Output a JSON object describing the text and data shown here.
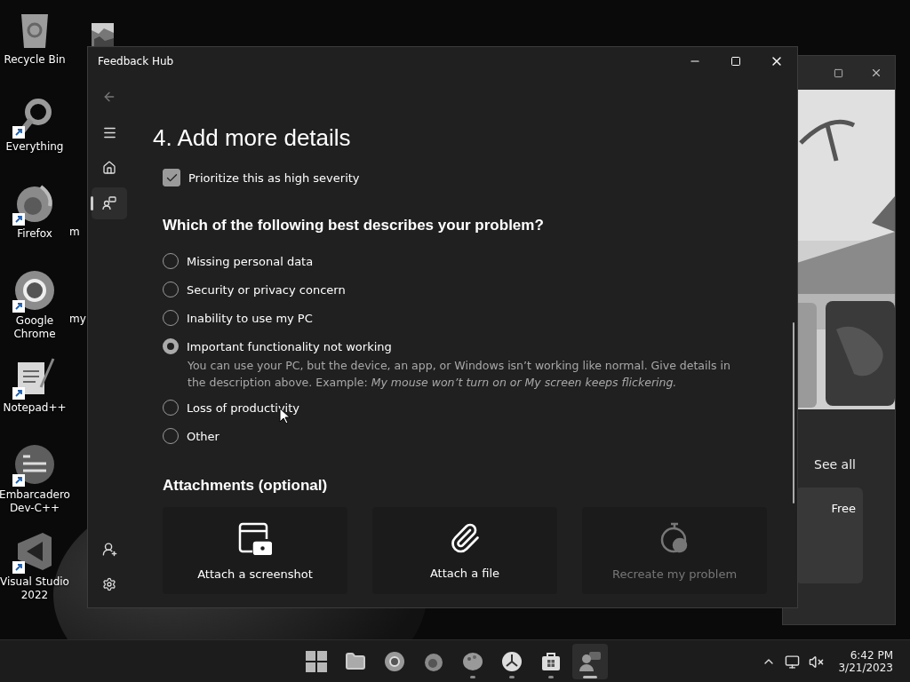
{
  "desktop_icons": [
    {
      "label": "Recycle Bin",
      "kind": "bin",
      "shortcut": false
    },
    {
      "label": "Everything",
      "kind": "magnifier",
      "shortcut": true
    },
    {
      "label": "Firefox",
      "kind": "firefox",
      "shortcut": true
    },
    {
      "label": "Google Chrome",
      "kind": "chrome",
      "shortcut": true
    },
    {
      "label": "Notepad++",
      "kind": "notepad",
      "shortcut": true
    },
    {
      "label": "Embarcadero Dev-C++",
      "kind": "devcpp",
      "shortcut": true
    },
    {
      "label": "Visual Studio 2022",
      "kind": "vs",
      "shortcut": true
    }
  ],
  "desktop_column_2": [
    {
      "label": "m"
    },
    {
      "label": "my"
    }
  ],
  "background_window": {
    "see_all": "See all",
    "card_label": "Free"
  },
  "window": {
    "title": "Feedback Hub",
    "nav_top": [
      {
        "kind": "back",
        "selected": false
      },
      {
        "kind": "menu",
        "selected": false
      },
      {
        "kind": "home",
        "selected": false
      },
      {
        "kind": "feedback",
        "selected": true
      }
    ],
    "nav_bottom": [
      {
        "kind": "add-user"
      },
      {
        "kind": "settings"
      }
    ],
    "heading": "4. Add more details",
    "severity": {
      "label": "Prioritize this as high severity",
      "checked": true
    },
    "question": "Which of the following best describes your problem?",
    "options": [
      {
        "label": "Missing personal data",
        "selected": false
      },
      {
        "label": "Security or privacy concern",
        "selected": false
      },
      {
        "label": "Inability to use my PC",
        "selected": false
      },
      {
        "label": "Important functionality not working",
        "selected": true,
        "description": "You can use your PC, but the device, an app, or Windows isn’t working like normal. Give details in the description above. Example: *My mouse won’t turn on or My screen keeps flickering.*"
      },
      {
        "label": "Loss of productivity",
        "selected": false
      },
      {
        "label": "Other",
        "selected": false
      }
    ],
    "attachments_heading": "Attachments (optional)",
    "attachments": [
      {
        "label": "Attach a screenshot",
        "kind": "screenshot",
        "disabled": false
      },
      {
        "label": "Attach a file",
        "kind": "file",
        "disabled": false
      },
      {
        "label": "Recreate my problem",
        "kind": "record",
        "disabled": true
      }
    ]
  },
  "taskbar": {
    "apps": [
      {
        "kind": "start",
        "running": false,
        "active": false
      },
      {
        "kind": "folder",
        "running": false,
        "active": false
      },
      {
        "kind": "chrome",
        "running": false,
        "active": false
      },
      {
        "kind": "firefox",
        "running": false,
        "active": false
      },
      {
        "kind": "paint",
        "running": true,
        "active": false
      },
      {
        "kind": "clock",
        "running": true,
        "active": false
      },
      {
        "kind": "store",
        "running": true,
        "active": false
      },
      {
        "kind": "feedback",
        "running": true,
        "active": true
      }
    ],
    "time": "6:42 PM",
    "date": "3/21/2023"
  }
}
